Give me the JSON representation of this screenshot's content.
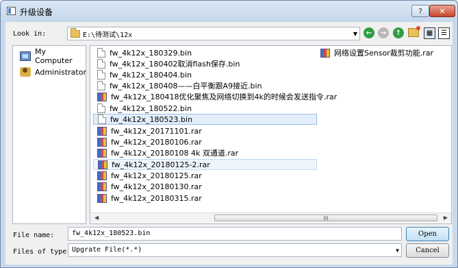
{
  "window": {
    "title": "升级设备",
    "help_label": "?",
    "close_label": "✕"
  },
  "lookin": {
    "label": "Look in:",
    "path": "E:\\待测试\\12x"
  },
  "sidebar": {
    "items": [
      {
        "label": "My Computer",
        "icon": "computer-icon"
      },
      {
        "label": "Administrator",
        "icon": "user-folder-icon"
      }
    ]
  },
  "files": [
    {
      "name": "fw_4k12x_180329.bin",
      "type": "bin"
    },
    {
      "name": "fw_4k12x_180402取消flash保存.bin",
      "type": "bin"
    },
    {
      "name": "fw_4k12x_180404.bin",
      "type": "bin"
    },
    {
      "name": "fw_4k12x_180408——白平衡跟A9接近.bin",
      "type": "bin"
    },
    {
      "name": "fw_4k12x_180418优化聚焦及网络切换到4k的时候会发送指令.rar",
      "type": "rar"
    },
    {
      "name": "fw_4k12x_180522.bin",
      "type": "bin"
    },
    {
      "name": "fw_4k12x_180523.bin",
      "type": "bin"
    },
    {
      "name": "fw_4k12x_20171101.rar",
      "type": "rar"
    },
    {
      "name": "fw_4k12x_20180106.rar",
      "type": "rar"
    },
    {
      "name": "fw_4k12x_20180108 4k 双通道.rar",
      "type": "rar"
    },
    {
      "name": "fw_4k12x_20180125-2.rar",
      "type": "rar"
    },
    {
      "name": "fw_4k12x_20180125.rar",
      "type": "rar"
    },
    {
      "name": "fw_4k12x_20180130.rar",
      "type": "rar"
    },
    {
      "name": "fw_4k12x_20180315.rar",
      "type": "rar"
    },
    {
      "name": "网络设置Sensor裁剪功能.rar",
      "type": "rar"
    }
  ],
  "scrollbar": {
    "thumb_glyph": "III"
  },
  "filename": {
    "label": "File name:",
    "value": "fw_4k12x_180523.bin"
  },
  "filetype": {
    "label": "Files of type:",
    "value": "Upgrate File(*.*)"
  },
  "buttons": {
    "open": "Open",
    "cancel": "Cancel"
  }
}
